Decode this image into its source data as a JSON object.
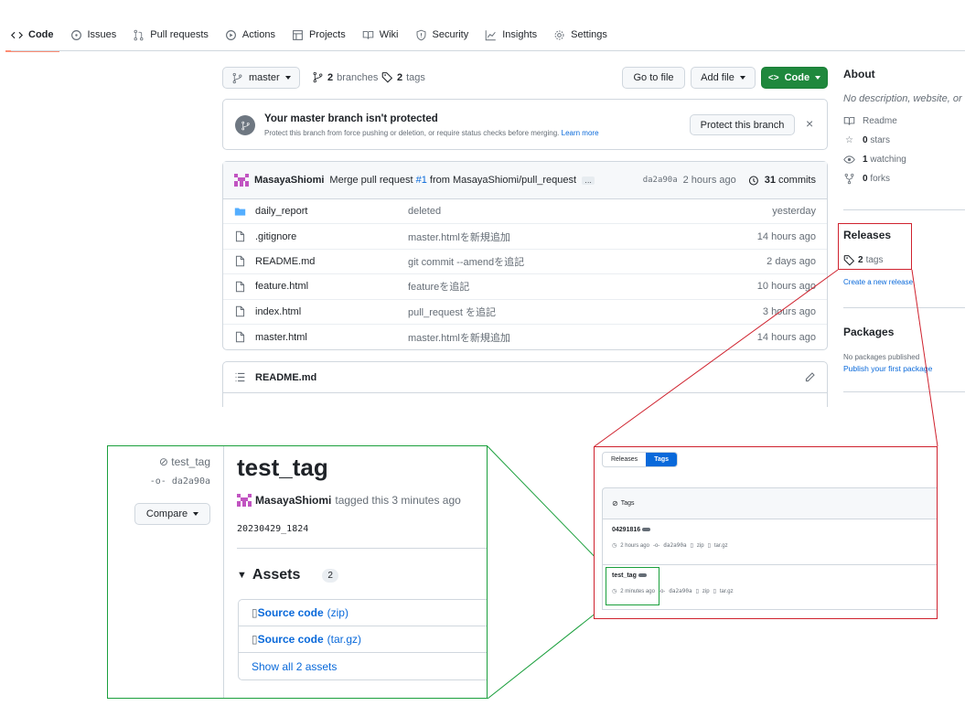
{
  "nav": {
    "items": [
      {
        "label": "Code",
        "icon": "code-icon",
        "active": true
      },
      {
        "label": "Issues",
        "icon": "issue-icon"
      },
      {
        "label": "Pull requests",
        "icon": "pull-request-icon"
      },
      {
        "label": "Actions",
        "icon": "play-icon"
      },
      {
        "label": "Projects",
        "icon": "table-icon"
      },
      {
        "label": "Wiki",
        "icon": "book-icon"
      },
      {
        "label": "Security",
        "icon": "shield-icon"
      },
      {
        "label": "Insights",
        "icon": "graph-icon"
      },
      {
        "label": "Settings",
        "icon": "gear-icon"
      }
    ]
  },
  "toolbar": {
    "branch": "master",
    "branches_count": "2",
    "branches_label": "branches",
    "tags_count": "2",
    "tags_label": "tags",
    "go_to_file": "Go to file",
    "add_file": "Add file",
    "code": "Code"
  },
  "protect": {
    "title": "Your master branch isn't protected",
    "desc": "Protect this branch from force pushing or deletion, or require status checks before merging.",
    "learn_more": "Learn more",
    "button": "Protect this branch"
  },
  "commit": {
    "author": "MasayaShiomi",
    "message_prefix": "Merge pull request",
    "pr": "#1",
    "message_suffix": "from MasayaShiomi/pull_request",
    "ellipsis": "…",
    "sha": "da2a90a",
    "age": "2 hours ago",
    "commits_count": "31",
    "commits_label": "commits"
  },
  "files": [
    {
      "name": "daily_report",
      "type": "folder",
      "message": "deleted",
      "age": "yesterday"
    },
    {
      "name": ".gitignore",
      "type": "file",
      "message": "master.htmlを新規追加",
      "age": "14 hours ago"
    },
    {
      "name": "README.md",
      "type": "file",
      "message": "git commit --amendを追記",
      "age": "2 days ago"
    },
    {
      "name": "feature.html",
      "type": "file",
      "message": "featureを追記",
      "age": "10 hours ago"
    },
    {
      "name": "index.html",
      "type": "file",
      "message": "pull_request を追記",
      "age": "3 hours ago"
    },
    {
      "name": "master.html",
      "type": "file",
      "message": "master.htmlを新規追加",
      "age": "14 hours ago"
    }
  ],
  "readme": {
    "label": "README.md"
  },
  "about": {
    "title": "About",
    "desc": "No description, website, or",
    "readme": "Readme",
    "stars_count": "0",
    "stars_label": "stars",
    "watching_count": "1",
    "watching_label": "watching",
    "forks_count": "0",
    "forks_label": "forks"
  },
  "releases": {
    "title": "Releases",
    "tags_count": "2",
    "tags_label": "tags",
    "create": "Create a new release"
  },
  "packages": {
    "title": "Packages",
    "none": "No packages published",
    "publish": "Publish your first package"
  },
  "tags_zoom": {
    "tab_releases": "Releases",
    "tab_tags": "Tags",
    "header": "Tags",
    "tags": [
      {
        "name": "04291816",
        "age": "2 hours ago",
        "sha": "da2a90a",
        "zip": "zip",
        "targz": "tar.gz"
      },
      {
        "name": "test_tag",
        "age": "2 minutes ago",
        "sha": "da2a90a",
        "zip": "zip",
        "targz": "tar.gz"
      }
    ]
  },
  "release_detail": {
    "tag": "test_tag",
    "sha": "da2a90a",
    "compare": "Compare",
    "title": "test_tag",
    "author": "MasayaShiomi",
    "tagged": "tagged this 3 minutes ago",
    "version": "20230429_1824",
    "assets_label": "Assets",
    "assets_count": "2",
    "assets": [
      {
        "name": "Source code",
        "ext": "(zip)"
      },
      {
        "name": "Source code",
        "ext": "(tar.gz)"
      }
    ],
    "show_all": "Show all 2 assets"
  },
  "colors": {
    "accent": "#0969da",
    "green_button": "#1f883d",
    "highlight_red": "#cf222e",
    "highlight_green": "#1a9f3c",
    "nav_underline": "#fd8c73"
  }
}
